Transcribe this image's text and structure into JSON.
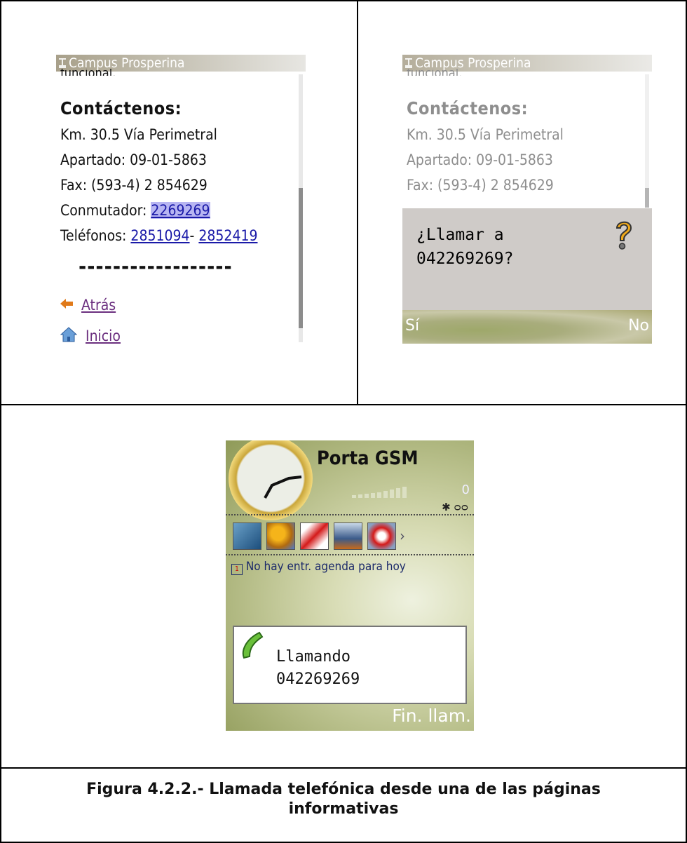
{
  "left_screen": {
    "title": "Campus Prosperina",
    "cut_text": "funcional.",
    "heading": "Contáctenos:",
    "address": "Km. 30.5 Vía Perimetral",
    "po_box": "Apartado: 09-01-5863",
    "fax": "Fax: (593-4) 2 854629",
    "switchboard_label": "Conmutador: ",
    "switchboard_number": "2269269",
    "phones_label": "Teléfonos: ",
    "phone_1": "2851094",
    "phone_sep": "- ",
    "phone_2": "2852419",
    "separator": "------------------",
    "back_link": "Atrás",
    "home_link": "Inicio"
  },
  "right_screen": {
    "title": "Campus Prosperina",
    "cut_text": "funcional.",
    "heading": "Contáctenos:",
    "address": "Km. 30.5 Vía Perimetral",
    "po_box": "Apartado: 09-01-5863",
    "fax": "Fax: (593-4) 2 854629",
    "dialog_line_1": "¿Llamar a",
    "dialog_line_2": "042269269?",
    "softkey_left": "Sí",
    "softkey_right": "No"
  },
  "idle_screen": {
    "operator": "Porta GSM",
    "signal_value": "0",
    "agenda": "No hay entr. agenda para hoy",
    "call_line_1": "Llamando",
    "call_line_2": "042269269",
    "softkey_right": "Fin. llam."
  },
  "caption": {
    "line_1": "Figura 4.2.2.- Llamada telefónica desde una de las páginas",
    "line_2": "informativas"
  },
  "colors": {
    "link": "#1a1aa8",
    "selection": "#b7b5f2",
    "dialog_bg": "#cfcbc8",
    "softkey_bg": "#a9ad7d"
  }
}
